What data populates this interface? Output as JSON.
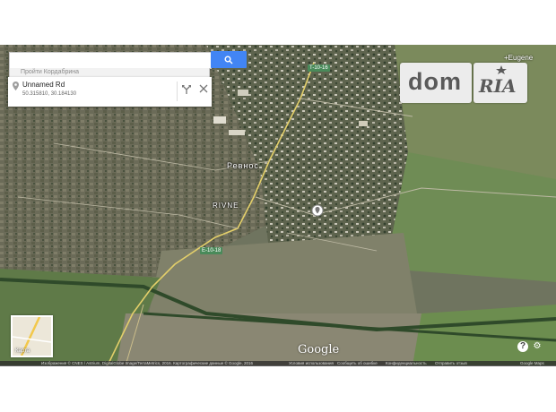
{
  "search": {
    "button_icon": "search-icon",
    "suggest_text": "Пройти Кордабрина"
  },
  "place_card": {
    "title": "Unnamed Rd",
    "coords": "50.315810, 30.184130",
    "icons": [
      "pin-icon",
      "directions-icon",
      "close-icon"
    ]
  },
  "user": {
    "label": "+Eugene"
  },
  "watermark": {
    "left": "dom",
    "right": "RIA"
  },
  "map": {
    "road_labels": [
      "T-10-16",
      "E-10-18"
    ],
    "town_labels": [
      "Ревнос",
      "RIVNE"
    ],
    "minimap_label": "Карта",
    "brand": "Google",
    "controls": [
      "help-icon",
      "settings-gear-icon"
    ]
  },
  "footer": {
    "items": [
      "Изображения © CNES / Astrium, DigitalGlobe Image/TerraMetrics, 2016. Картографические данные © Google, 2016",
      "Условия использования",
      "Сообщить об ошибке",
      "Конфиденциальность",
      "Отправить отзыв",
      "Google Maps"
    ]
  },
  "colors": {
    "search_button": "#4285f4",
    "field": "#7d7f66",
    "road": "#e3cf6a"
  }
}
